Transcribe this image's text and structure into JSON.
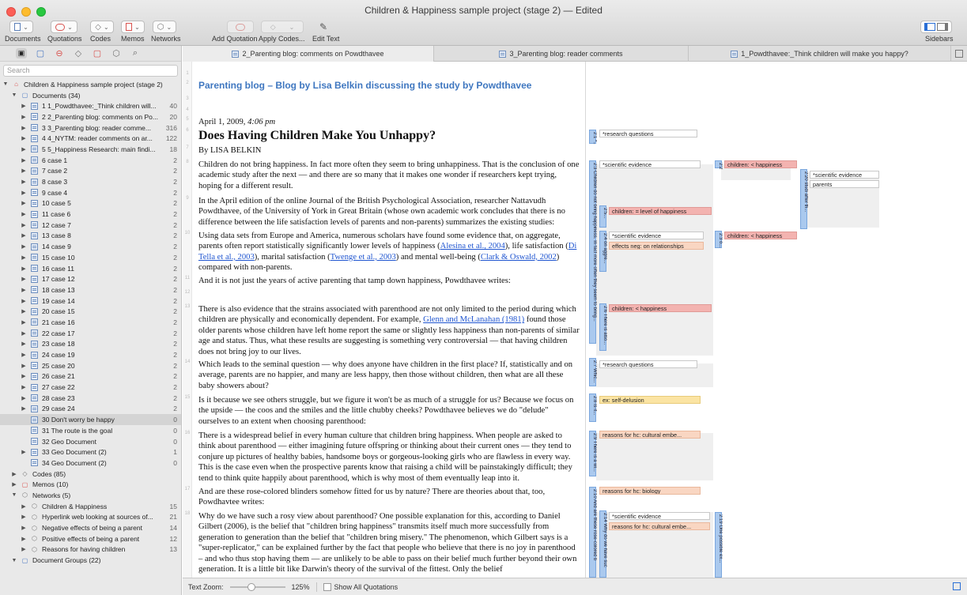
{
  "window": {
    "title": "Children & Happiness sample project (stage 2) — Edited"
  },
  "toolbar": {
    "documents": "Documents",
    "quotations": "Quotations",
    "codes": "Codes",
    "memos": "Memos",
    "networks": "Networks",
    "add_quotation": "Add Quotation",
    "apply_codes": "Apply Codes...",
    "edit_text": "Edit Text",
    "sidebars": "Sidebars"
  },
  "sidebar": {
    "search_placeholder": "Search",
    "project": "Children & Happiness sample project (stage 2)",
    "documents_label": "Documents (34)",
    "documents": [
      {
        "label": "1 1_Powdthavee:_Think children will...",
        "count": "40"
      },
      {
        "label": "2 2_Parenting blog: comments on Po...",
        "count": "20"
      },
      {
        "label": "3 3_Parenting blog: reader comme...",
        "count": "316"
      },
      {
        "label": "4 4_NYTM: reader comments on ar...",
        "count": "122"
      },
      {
        "label": "5 5_Happiness Research: main findi...",
        "count": "18"
      },
      {
        "label": "6 case 1",
        "count": "2"
      },
      {
        "label": "7 case 2",
        "count": "2"
      },
      {
        "label": "8 case 3",
        "count": "2"
      },
      {
        "label": "9 case 4",
        "count": "2"
      },
      {
        "label": "10 case 5",
        "count": "2"
      },
      {
        "label": "11 case 6",
        "count": "2"
      },
      {
        "label": "12 case 7",
        "count": "2"
      },
      {
        "label": "13 case 8",
        "count": "2"
      },
      {
        "label": "14 case 9",
        "count": "2"
      },
      {
        "label": "15 case 10",
        "count": "2"
      },
      {
        "label": "16 case 11",
        "count": "2"
      },
      {
        "label": "17 case 12",
        "count": "2"
      },
      {
        "label": "18 case 13",
        "count": "2"
      },
      {
        "label": "19 case 14",
        "count": "2"
      },
      {
        "label": "20 case 15",
        "count": "2"
      },
      {
        "label": "21 case 16",
        "count": "2"
      },
      {
        "label": "22 case 17",
        "count": "2"
      },
      {
        "label": "23 case 18",
        "count": "2"
      },
      {
        "label": "24 case 19",
        "count": "2"
      },
      {
        "label": "25 case 20",
        "count": "2"
      },
      {
        "label": "26 case 21",
        "count": "2"
      },
      {
        "label": "27 case 22",
        "count": "2"
      },
      {
        "label": "28 case 23",
        "count": "2"
      },
      {
        "label": "29 case 24",
        "count": "2"
      },
      {
        "label": "30 Don't worry be happy",
        "count": "0"
      },
      {
        "label": "31 The route is the goal",
        "count": "0"
      },
      {
        "label": "32 Geo Document",
        "count": "0"
      },
      {
        "label": "33 Geo Document (2)",
        "count": "1"
      },
      {
        "label": "34 Geo Document (2)",
        "count": "0"
      }
    ],
    "codes_label": "Codes (85)",
    "memos_label": "Memos (10)",
    "networks_label": "Networks (5)",
    "networks": [
      {
        "label": "Children & Happiness",
        "count": "15"
      },
      {
        "label": "Hyperlink web looking at sources of...",
        "count": "21"
      },
      {
        "label": "Negative effects of being a parent",
        "count": "14"
      },
      {
        "label": "Positive effects of being a parent",
        "count": "12"
      },
      {
        "label": "Reasons for having children",
        "count": "13"
      }
    ],
    "groups_label": "Document Groups (22)"
  },
  "tabs": [
    "2_Parenting blog: comments on Powdthavee",
    "3_Parenting blog: reader comments",
    "1_Powdthavee:_Think children will make you happy?"
  ],
  "doc": {
    "heading": "Parenting blog – Blog by Lisa Belkin discussing the study by Powdthavee",
    "date": "April 1, 2009, ",
    "time": "4:06 pm",
    "title": "Does Having Children Make You Unhappy?",
    "byline": "By LISA BELKIN",
    "p1": "Children do not bring happiness. In fact more often they seem to bring unhappiness. That is the conclusion of one academic study after the next — and there are so many that it makes one wonder if researchers kept trying, hoping for a different result.",
    "p2": "In the April edition of the online Journal of the British Psychological Association, researcher Nattavudh Powdthavee, of the University of York in Great Britain (whose own academic work concludes that there is no difference between the life satisfaction levels of parents and non-parents) summarizes the existing studies:",
    "p3a": "Using data sets from Europe and America, numerous scholars have found some evidence that, on aggregate, parents often report statistically significantly lower levels of happiness (",
    "l1": "Alesina et al., 2004",
    "p3b": "), life satisfaction (",
    "l2": "Di Tella et al., 2003",
    "p3c": "), marital satisfaction (",
    "l3": "Twenge et al., 2003",
    "p3d": ") and mental well-being (",
    "l4": "Clark & Oswald, 2002",
    "p3e": ") compared with non-parents.",
    "p4": "And it is not just the years of active parenting that tamp down happiness, Powdthavee writes:",
    "p5a": "There is also evidence that the strains associated with parenthood are not only limited to the period during which children are physically and economically dependent. For example, ",
    "l5": "Glenn and McLanahan (1981)",
    "p5b": " found those older parents whose children have left home report the same or slightly less happiness than non-parents of similar age and status. Thus, what these results are suggesting is something very controversial — that having children does not bring joy to our lives.",
    "p6": "Which leads to the seminal question — why does anyone have children in the first place? If, statistically and on average, parents are no happier, and many are less happy, then those without children, then what are all these baby showers about?",
    "p7": "Is it because we see others struggle, but we figure it won't be as much of a struggle for us? Because we focus on the upside — the coos and the smiles and the little chubby cheeks? Powdthavee believes we do \"delude\" ourselves to an extent when choosing parenthood:",
    "p8": "There is a widespread belief in every human culture that children bring happiness. When people are asked to think about parenthood — either imagining future offspring or thinking about their current ones — they tend to conjure up pictures of healthy babies, handsome boys or gorgeous-looking girls who are flawless in every way. This is the case even when the prospective parents know that raising a child will be painstakingly difficult; they tend to think quite happily about parenthood, which is why most of them eventually leap into it.",
    "p9": "And are these rose-colored blinders somehow fitted for us by nature? There are theories about that, too, Powdhavtee writes:",
    "p10": "Why do we have such a rosy view about parenthood? One possible explanation for this, according to Daniel Gilbert (2006), is the belief that \"children bring happiness\" transmits itself much more successfully from generation to generation than the belief that \"children bring misery.\" The phenomenon, which Gilbert says is a \"super-replicator,\" can be explained further by the fact that people who believe that there is no joy in parenthood – and who thus stop having them — are unlikely to be able to pass on their belief much further beyond their own generation. It is a little bit like Darwin's theory of the survival of the fittest. Only the belief"
  },
  "margin": {
    "bars": [
      "2:1 *...",
      "2:3 Children do not bring happiness. In fact more often they seem to bring...",
      "2:5...",
      "2:4 on aggre...",
      "2:6 There is also...",
      "2:7 Whic...",
      "2:8 Is it...",
      "2:9 There is a wi...",
      "2:10 And are these rose-colored b",
      "2:14 Why do we have suc",
      "2:2 *...",
      "2:3 o...",
      "2:19 One possible ex...",
      "2:20 studi after th..."
    ],
    "codes": [
      "*research questions",
      "*scientific evidence",
      "children: = level of happiness",
      "*scientific evidence",
      "effects neg: on relationships",
      "children: < happiness",
      "*research questions",
      "ex: self-delusion",
      "reasons for hc: cultural embe...",
      "reasons for hc: biology",
      "*scientific evidence",
      "reasons for hc: cultural embe...",
      "children: < happiness",
      "children: < happiness",
      "*scientific evidence",
      "parents"
    ]
  },
  "status": {
    "zoom_label": "Text Zoom:",
    "zoom_value": "125%",
    "show_all": "Show All Quotations"
  }
}
